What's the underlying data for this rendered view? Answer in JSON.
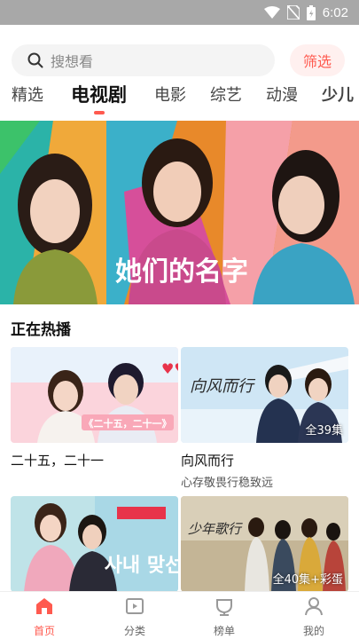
{
  "status_bar": {
    "time": "6:02"
  },
  "search": {
    "placeholder": "搜想看",
    "filter_label": "筛选"
  },
  "tabs": [
    {
      "label": "精选",
      "active": false
    },
    {
      "label": "电视剧",
      "active": true
    },
    {
      "label": "电影",
      "active": false
    },
    {
      "label": "综艺",
      "active": false
    },
    {
      "label": "动漫",
      "active": false
    },
    {
      "label": "少儿",
      "active": false
    }
  ],
  "banner": {
    "title": "她们的名字"
  },
  "section": {
    "title": "正在热播"
  },
  "cards": [
    {
      "title": "二十五，二十一",
      "subtitle": "",
      "episodes": "",
      "poster_text": "《二十五，二十一》"
    },
    {
      "title": "向风而行",
      "subtitle": "心存敬畏行稳致远",
      "episodes": "全39集",
      "poster_text": "向风而行"
    },
    {
      "title": "",
      "subtitle": "",
      "episodes": "",
      "poster_text": "사내 맞선"
    },
    {
      "title": "",
      "subtitle": "",
      "episodes": "全40集+彩蛋",
      "poster_text": "少年歌行"
    }
  ],
  "bottom_nav": [
    {
      "label": "首页",
      "icon": "home-icon",
      "active": true
    },
    {
      "label": "分类",
      "icon": "category-icon",
      "active": false
    },
    {
      "label": "榜单",
      "icon": "ranking-icon",
      "active": false
    },
    {
      "label": "我的",
      "icon": "profile-icon",
      "active": false
    }
  ],
  "colors": {
    "accent": "#ff5a4f"
  }
}
